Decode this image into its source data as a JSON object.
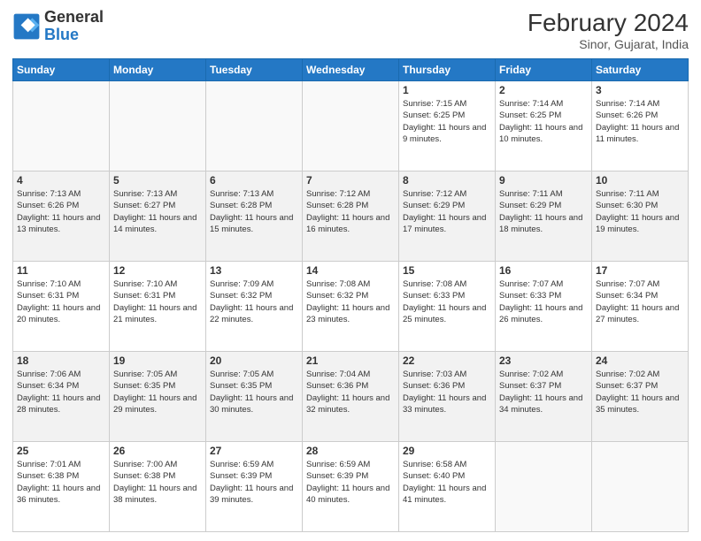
{
  "header": {
    "logo_line1": "General",
    "logo_line2": "Blue",
    "month_year": "February 2024",
    "location": "Sinor, Gujarat, India"
  },
  "days_of_week": [
    "Sunday",
    "Monday",
    "Tuesday",
    "Wednesday",
    "Thursday",
    "Friday",
    "Saturday"
  ],
  "weeks": [
    {
      "alt": false,
      "days": [
        {
          "num": "",
          "info": ""
        },
        {
          "num": "",
          "info": ""
        },
        {
          "num": "",
          "info": ""
        },
        {
          "num": "",
          "info": ""
        },
        {
          "num": "1",
          "info": "Sunrise: 7:15 AM\nSunset: 6:25 PM\nDaylight: 11 hours and 9 minutes."
        },
        {
          "num": "2",
          "info": "Sunrise: 7:14 AM\nSunset: 6:25 PM\nDaylight: 11 hours and 10 minutes."
        },
        {
          "num": "3",
          "info": "Sunrise: 7:14 AM\nSunset: 6:26 PM\nDaylight: 11 hours and 11 minutes."
        }
      ]
    },
    {
      "alt": true,
      "days": [
        {
          "num": "4",
          "info": "Sunrise: 7:13 AM\nSunset: 6:26 PM\nDaylight: 11 hours and 13 minutes."
        },
        {
          "num": "5",
          "info": "Sunrise: 7:13 AM\nSunset: 6:27 PM\nDaylight: 11 hours and 14 minutes."
        },
        {
          "num": "6",
          "info": "Sunrise: 7:13 AM\nSunset: 6:28 PM\nDaylight: 11 hours and 15 minutes."
        },
        {
          "num": "7",
          "info": "Sunrise: 7:12 AM\nSunset: 6:28 PM\nDaylight: 11 hours and 16 minutes."
        },
        {
          "num": "8",
          "info": "Sunrise: 7:12 AM\nSunset: 6:29 PM\nDaylight: 11 hours and 17 minutes."
        },
        {
          "num": "9",
          "info": "Sunrise: 7:11 AM\nSunset: 6:29 PM\nDaylight: 11 hours and 18 minutes."
        },
        {
          "num": "10",
          "info": "Sunrise: 7:11 AM\nSunset: 6:30 PM\nDaylight: 11 hours and 19 minutes."
        }
      ]
    },
    {
      "alt": false,
      "days": [
        {
          "num": "11",
          "info": "Sunrise: 7:10 AM\nSunset: 6:31 PM\nDaylight: 11 hours and 20 minutes."
        },
        {
          "num": "12",
          "info": "Sunrise: 7:10 AM\nSunset: 6:31 PM\nDaylight: 11 hours and 21 minutes."
        },
        {
          "num": "13",
          "info": "Sunrise: 7:09 AM\nSunset: 6:32 PM\nDaylight: 11 hours and 22 minutes."
        },
        {
          "num": "14",
          "info": "Sunrise: 7:08 AM\nSunset: 6:32 PM\nDaylight: 11 hours and 23 minutes."
        },
        {
          "num": "15",
          "info": "Sunrise: 7:08 AM\nSunset: 6:33 PM\nDaylight: 11 hours and 25 minutes."
        },
        {
          "num": "16",
          "info": "Sunrise: 7:07 AM\nSunset: 6:33 PM\nDaylight: 11 hours and 26 minutes."
        },
        {
          "num": "17",
          "info": "Sunrise: 7:07 AM\nSunset: 6:34 PM\nDaylight: 11 hours and 27 minutes."
        }
      ]
    },
    {
      "alt": true,
      "days": [
        {
          "num": "18",
          "info": "Sunrise: 7:06 AM\nSunset: 6:34 PM\nDaylight: 11 hours and 28 minutes."
        },
        {
          "num": "19",
          "info": "Sunrise: 7:05 AM\nSunset: 6:35 PM\nDaylight: 11 hours and 29 minutes."
        },
        {
          "num": "20",
          "info": "Sunrise: 7:05 AM\nSunset: 6:35 PM\nDaylight: 11 hours and 30 minutes."
        },
        {
          "num": "21",
          "info": "Sunrise: 7:04 AM\nSunset: 6:36 PM\nDaylight: 11 hours and 32 minutes."
        },
        {
          "num": "22",
          "info": "Sunrise: 7:03 AM\nSunset: 6:36 PM\nDaylight: 11 hours and 33 minutes."
        },
        {
          "num": "23",
          "info": "Sunrise: 7:02 AM\nSunset: 6:37 PM\nDaylight: 11 hours and 34 minutes."
        },
        {
          "num": "24",
          "info": "Sunrise: 7:02 AM\nSunset: 6:37 PM\nDaylight: 11 hours and 35 minutes."
        }
      ]
    },
    {
      "alt": false,
      "days": [
        {
          "num": "25",
          "info": "Sunrise: 7:01 AM\nSunset: 6:38 PM\nDaylight: 11 hours and 36 minutes."
        },
        {
          "num": "26",
          "info": "Sunrise: 7:00 AM\nSunset: 6:38 PM\nDaylight: 11 hours and 38 minutes."
        },
        {
          "num": "27",
          "info": "Sunrise: 6:59 AM\nSunset: 6:39 PM\nDaylight: 11 hours and 39 minutes."
        },
        {
          "num": "28",
          "info": "Sunrise: 6:59 AM\nSunset: 6:39 PM\nDaylight: 11 hours and 40 minutes."
        },
        {
          "num": "29",
          "info": "Sunrise: 6:58 AM\nSunset: 6:40 PM\nDaylight: 11 hours and 41 minutes."
        },
        {
          "num": "",
          "info": ""
        },
        {
          "num": "",
          "info": ""
        }
      ]
    }
  ]
}
